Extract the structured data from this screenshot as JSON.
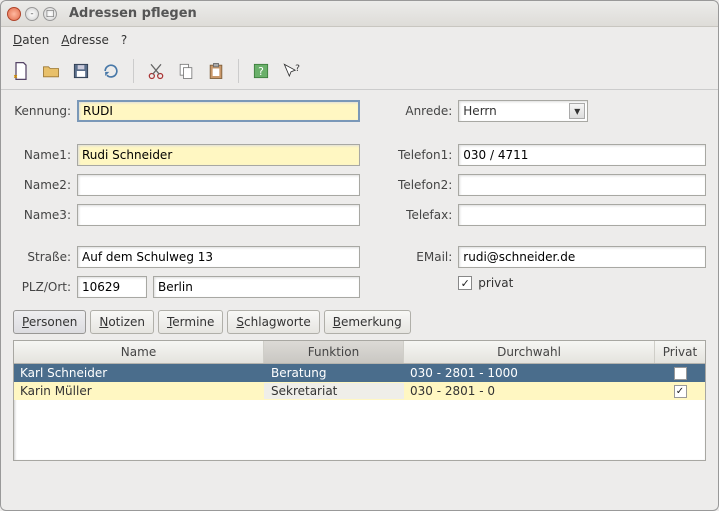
{
  "window": {
    "title": "Adressen pflegen"
  },
  "menu": {
    "daten": "Daten",
    "adresse": "Adresse",
    "help": "?"
  },
  "toolbar_icons": [
    "new",
    "open",
    "save",
    "refresh",
    "cut",
    "copy",
    "paste",
    "help",
    "whatsthis"
  ],
  "labels": {
    "kennung": "Kennung:",
    "name1": "Name1:",
    "name2": "Name2:",
    "name3": "Name3:",
    "strasse": "Straße:",
    "plzort": "PLZ/Ort:",
    "anrede": "Anrede:",
    "telefon1": "Telefon1:",
    "telefon2": "Telefon2:",
    "telefax": "Telefax:",
    "email": "EMail:",
    "privat": "privat"
  },
  "fields": {
    "kennung": "RUDI",
    "name1": "Rudi Schneider",
    "name2": "",
    "name3": "",
    "strasse": "Auf dem Schulweg 13",
    "plz": "10629",
    "ort": "Berlin",
    "anrede": "Herrn",
    "telefon1": "030 / 4711",
    "telefon2": "",
    "telefax": "",
    "email": "rudi@schneider.de",
    "privat": true
  },
  "tabs": {
    "personen": "Personen",
    "notizen": "Notizen",
    "termine": "Termine",
    "schlagworte": "Schlagworte",
    "bemerkung": "Bemerkung",
    "active": "personen"
  },
  "grid": {
    "columns": {
      "name": "Name",
      "funktion": "Funktion",
      "durchwahl": "Durchwahl",
      "privat": "Privat"
    },
    "rows": [
      {
        "name": "Karl Schneider",
        "funktion": "Beratung",
        "durchwahl": "030 - 2801 - 1000",
        "privat": false,
        "selected": true
      },
      {
        "name": "Karin Müller",
        "funktion": "Sekretariat",
        "durchwahl": "030 - 2801 - 0",
        "privat": true,
        "selected": false
      }
    ]
  }
}
